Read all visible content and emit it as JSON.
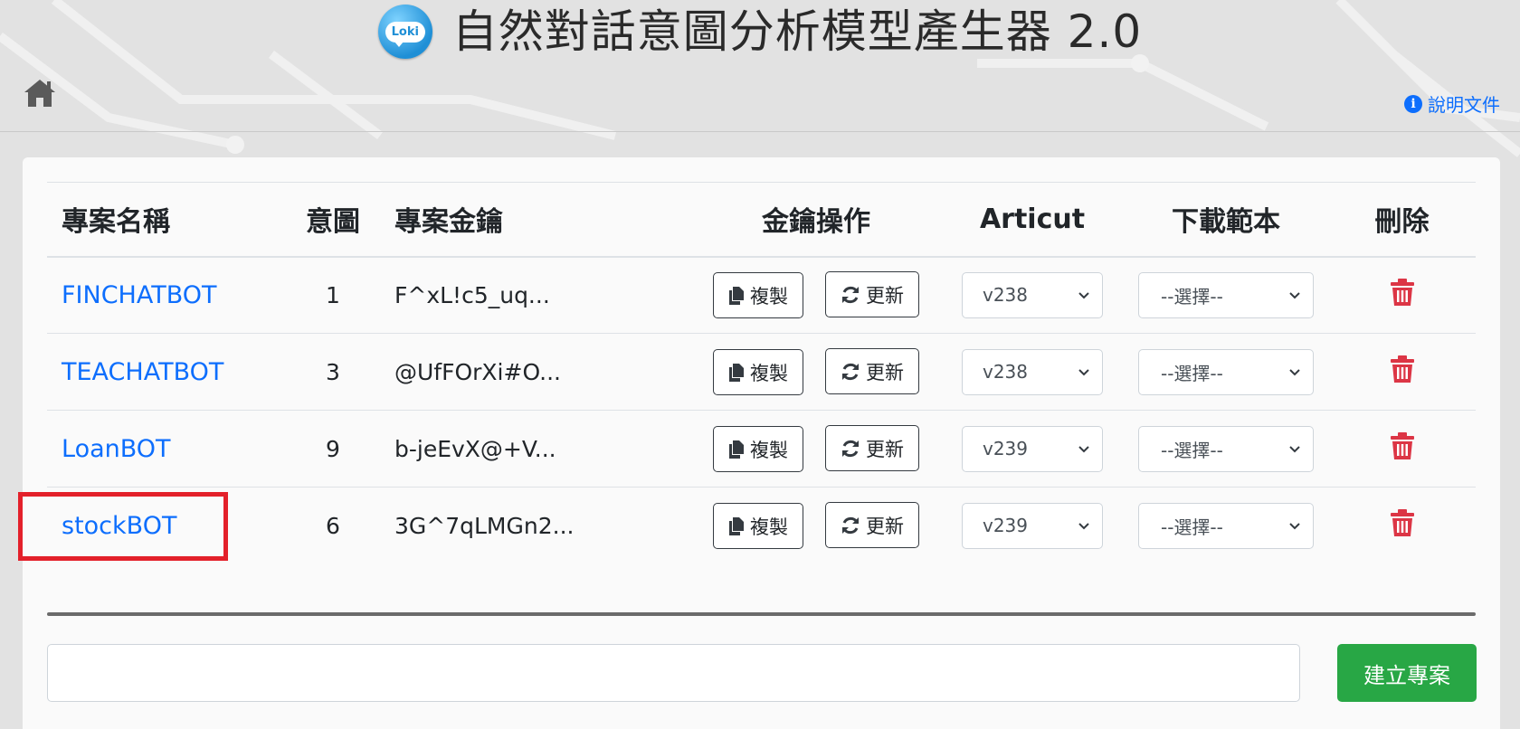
{
  "header": {
    "logo_text": "Loki",
    "title": "自然對話意圖分析模型產生器 2.0",
    "docs_label": "說明文件"
  },
  "table": {
    "columns": [
      "專案名稱",
      "意圖",
      "專案金鑰",
      "金鑰操作",
      "Articut",
      "下載範本",
      "刪除"
    ],
    "rows": [
      {
        "name": "FINCHATBOT",
        "intents": "1",
        "key": "F^xL!c5_uq...",
        "copy": "複製",
        "refresh": "更新",
        "articut": "v238",
        "template": "--選擇--"
      },
      {
        "name": "TEACHATBOT",
        "intents": "3",
        "key": "@UfFOrXi#O...",
        "copy": "複製",
        "refresh": "更新",
        "articut": "v238",
        "template": "--選擇--"
      },
      {
        "name": "LoanBOT",
        "intents": "9",
        "key": "b-jeEvX@+V...",
        "copy": "複製",
        "refresh": "更新",
        "articut": "v239",
        "template": "--選擇--"
      },
      {
        "name": "stockBOT",
        "intents": "6",
        "key": "3G^7qLMGn2...",
        "copy": "複製",
        "refresh": "更新",
        "articut": "v239",
        "template": "--選擇--"
      }
    ]
  },
  "form": {
    "input_value": "",
    "create_label": "建立專案"
  },
  "colors": {
    "link": "#0d6efd",
    "delete": "#dc3545",
    "create": "#28a745",
    "highlight": "#e3202a"
  }
}
